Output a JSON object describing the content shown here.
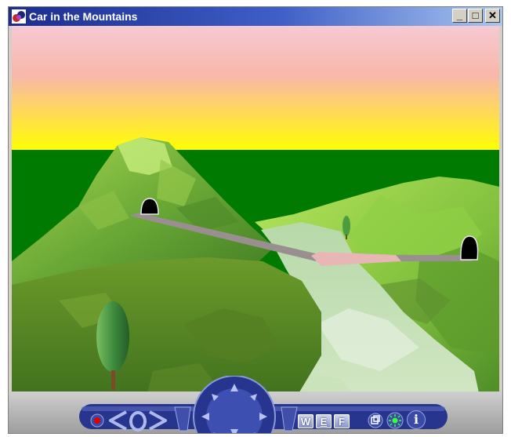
{
  "window": {
    "title": "Car in the Mountains",
    "controls": {
      "minimize": "_",
      "maximize": "□",
      "close": "✕"
    }
  },
  "toolbar": {
    "mode_buttons": [
      "W",
      "E",
      "F"
    ],
    "info_label": "i",
    "icons": [
      "record-icon",
      "previous-viewpoint-icon",
      "go-icon",
      "next-viewpoint-icon",
      "navigation-compass-icon",
      "fit-view-icon",
      "headlight-icon",
      "info-icon"
    ]
  },
  "colors": {
    "title_bar_start": "#1b2d8f",
    "title_bar_end": "#a9c6ef",
    "toolbar_navy": "#27358f",
    "ground_green": "#007a00",
    "sky_yellow": "#ffff00",
    "sky_pink": "#f6c9d3",
    "road": "#9a8f90"
  }
}
